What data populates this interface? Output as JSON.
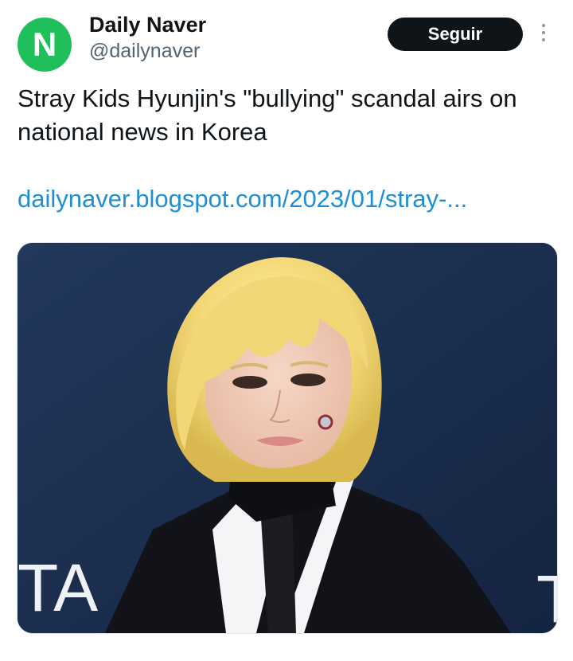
{
  "account": {
    "avatar_letter": "N",
    "avatar_color": "#1fbf5b",
    "name": "Daily Naver",
    "handle": "@dailynaver"
  },
  "actions": {
    "follow_label": "Seguir",
    "more_icon": "more-vertical-icon"
  },
  "tweet": {
    "text": "Stray Kids Hyunjin's \"bullying\" scandal airs on national news in Korea",
    "link": "dailynaver.blogspot.com/2023/01/stray-..."
  },
  "media": {
    "backdrop_text_left": "TA",
    "backdrop_text_right": "T"
  },
  "colors": {
    "link": "#1d8fd4",
    "button_bg": "#0f1419",
    "handle": "#536471",
    "backdrop": "#1a2b48"
  }
}
